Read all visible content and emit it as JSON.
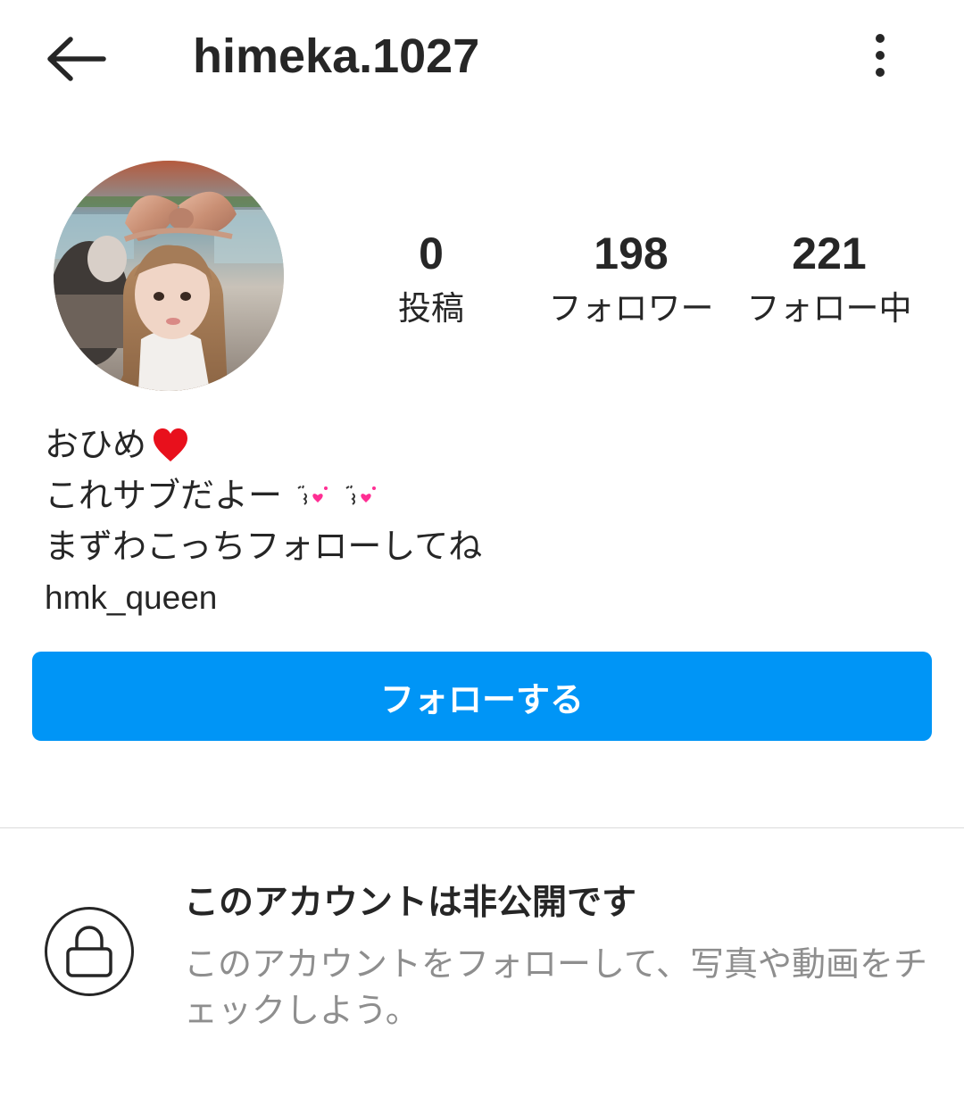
{
  "header": {
    "username": "himeka.1027",
    "back_icon": "arrow-left-icon",
    "menu_icon": "more-vertical-icon"
  },
  "profile": {
    "avatar_icon": "profile-photo",
    "stats": {
      "posts": {
        "count": "0",
        "label": "投稿"
      },
      "followers": {
        "count": "198",
        "label": "フォロワー"
      },
      "following": {
        "count": "221",
        "label": "フォロー中"
      }
    },
    "bio": {
      "line1": "おひめ",
      "line1_emoji": "red-heart-icon",
      "line2": "これサブだよー",
      "line2_emoji": "kissing-face-icon",
      "line3": "まずわこっちフォローしてね",
      "link": "hmk_queen"
    }
  },
  "actions": {
    "follow_label": "フォローする"
  },
  "private_notice": {
    "icon": "lock-icon",
    "title": "このアカウントは非公開です",
    "description": "このアカウントをフォローして、写真や動画をチェックしよう。"
  },
  "colors": {
    "primary_button": "#0095f6",
    "text": "#262626",
    "secondary_text": "#8e8e8e",
    "divider": "#dbdbdb"
  }
}
